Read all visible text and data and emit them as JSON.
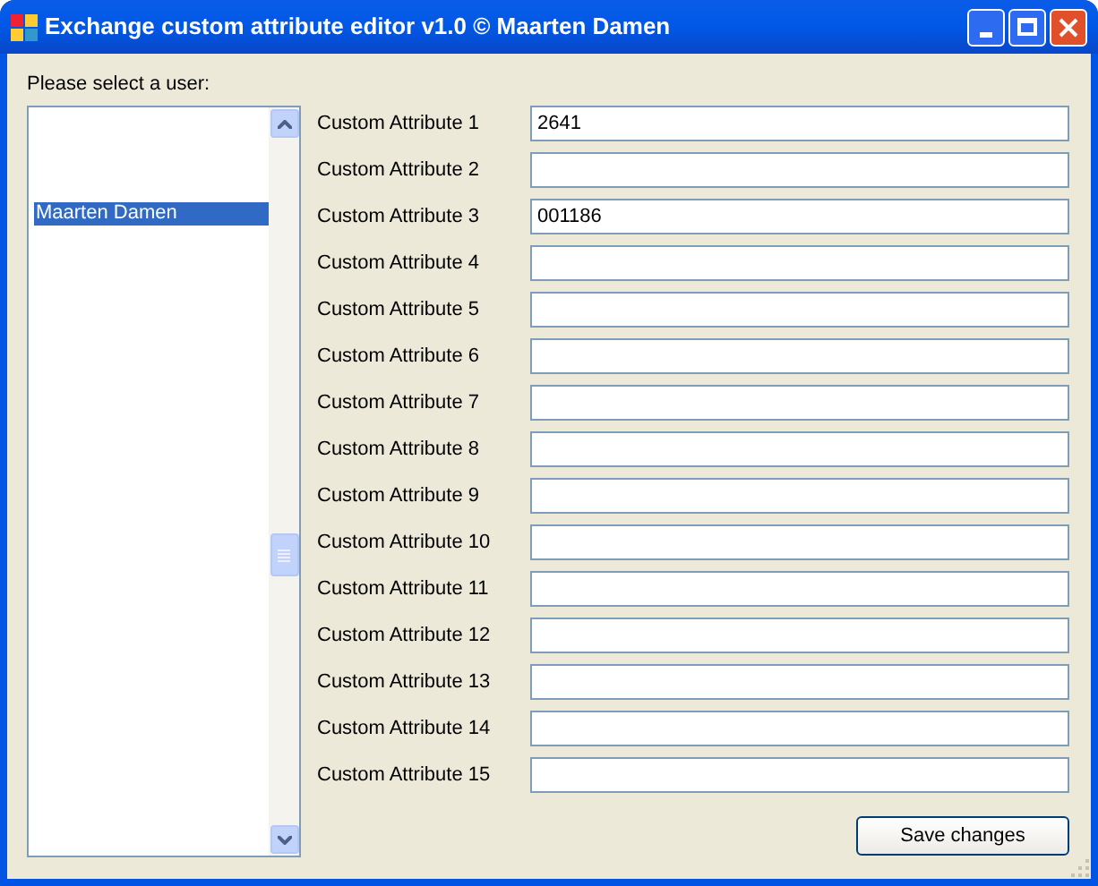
{
  "window": {
    "title": "Exchange custom attribute editor v1.0 © Maarten Damen"
  },
  "user_list": {
    "label": "Please select a user:",
    "items": [
      {
        "name": "Maarten Damen",
        "selected": true
      }
    ]
  },
  "attributes": [
    {
      "label": "Custom Attribute 1",
      "value": "2641"
    },
    {
      "label": "Custom Attribute 2"
    },
    {
      "label": "Custom Attribute 3",
      "value": "001186"
    },
    {
      "label": "Custom Attribute 4"
    },
    {
      "label": "Custom Attribute 5"
    },
    {
      "label": "Custom Attribute 6"
    },
    {
      "label": "Custom Attribute 7"
    },
    {
      "label": "Custom Attribute 8"
    },
    {
      "label": "Custom Attribute 9"
    },
    {
      "label": "Custom Attribute 10"
    },
    {
      "label": "Custom Attribute 11"
    },
    {
      "label": "Custom Attribute 12"
    },
    {
      "label": "Custom Attribute 13"
    },
    {
      "label": "Custom Attribute 14"
    },
    {
      "label": "Custom Attribute 15"
    }
  ],
  "save_button": "Save changes"
}
